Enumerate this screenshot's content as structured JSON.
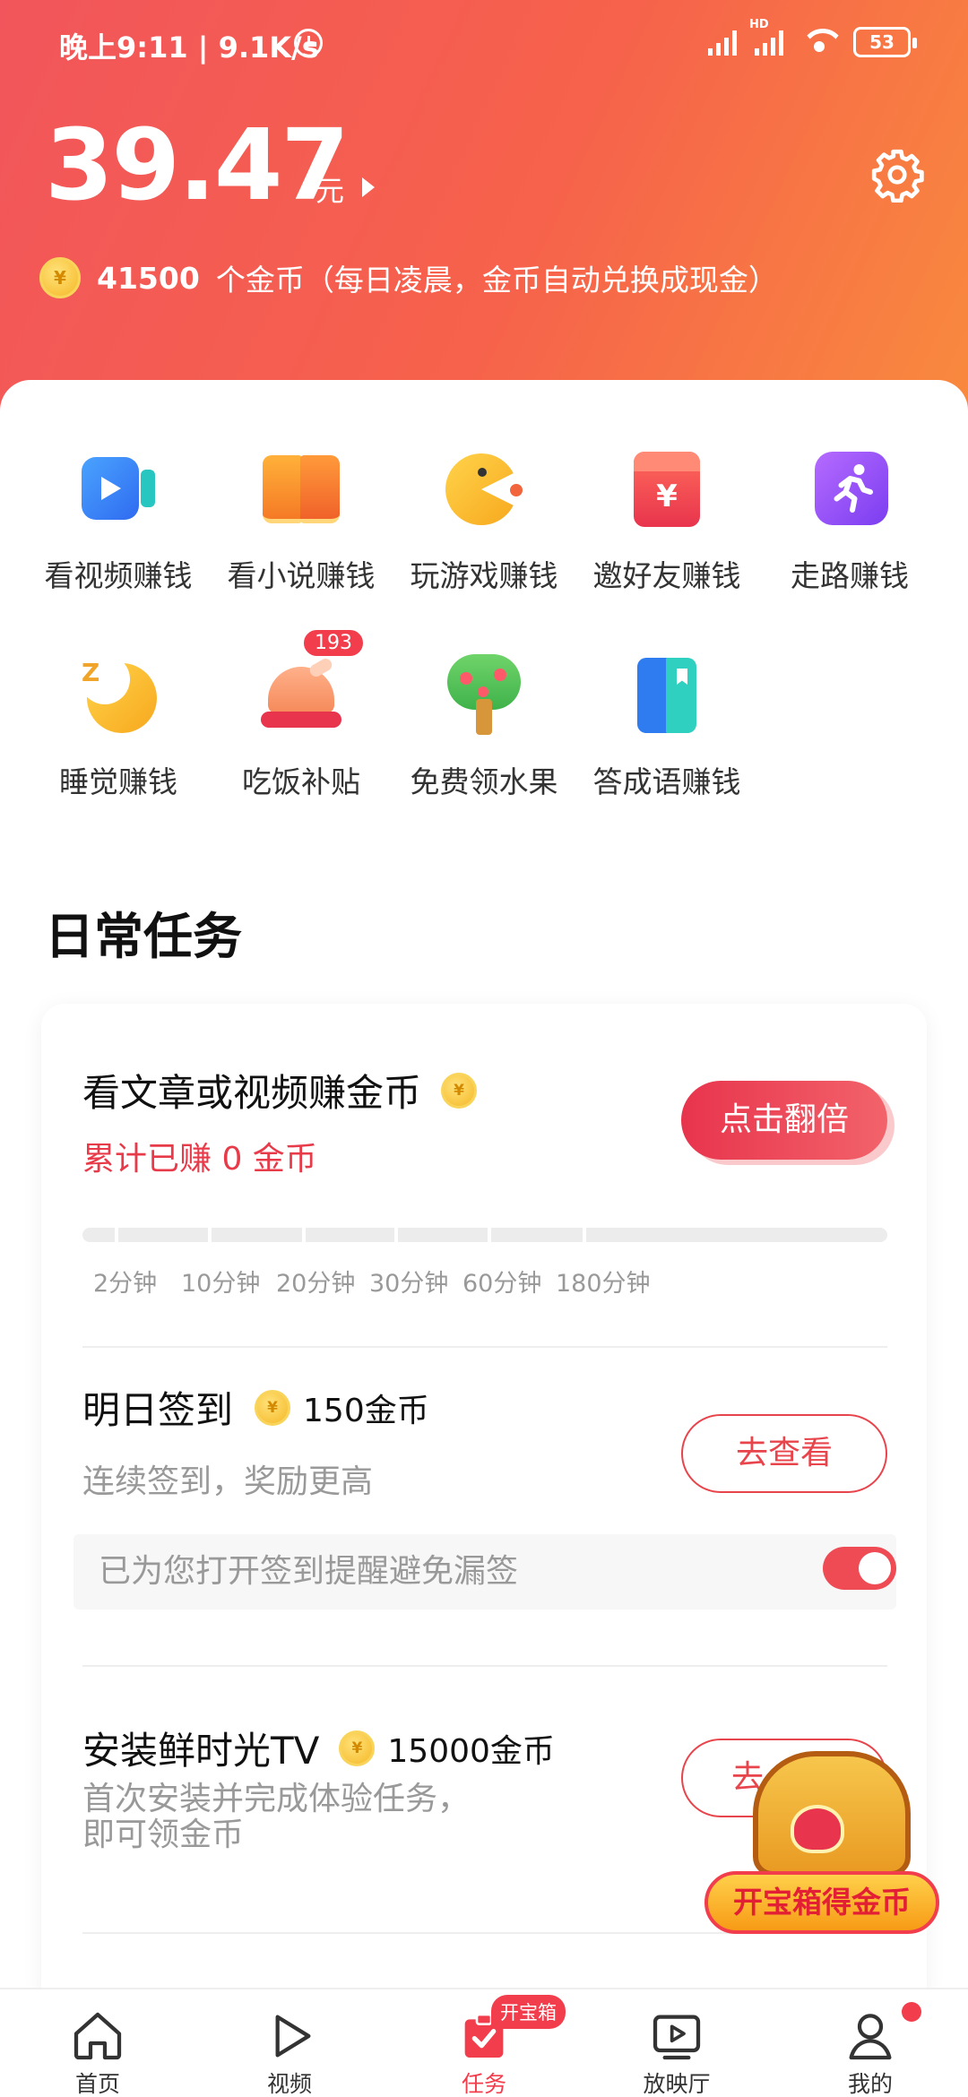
{
  "status_bar": {
    "time": "晚上9:11 | 9.1K/s",
    "network_hd": "HD",
    "battery": "53"
  },
  "wallet": {
    "balance": "39.47",
    "unit": "元",
    "coins": "41500",
    "coins_text": "个金币（每日凌晨，金币自动兑换成现金）"
  },
  "coin_glyph": "¥",
  "shortcuts": [
    {
      "label": "看视频赚钱",
      "icon": "video-icon"
    },
    {
      "label": "看小说赚钱",
      "icon": "book-icon"
    },
    {
      "label": "玩游戏赚钱",
      "icon": "pacman-game-icon"
    },
    {
      "label": "邀好友赚钱",
      "icon": "red-envelope-icon"
    },
    {
      "label": "走路赚钱",
      "icon": "running-icon"
    },
    {
      "label": "睡觉赚钱",
      "icon": "moon-icon"
    },
    {
      "label": "吃饭补贴",
      "icon": "chicken-meal-icon",
      "badge": "193"
    },
    {
      "label": "免费领水果",
      "icon": "fruit-tree-icon"
    },
    {
      "label": "答成语赚钱",
      "icon": "idiom-book-icon"
    }
  ],
  "daily": {
    "title": "日常任务",
    "task1": {
      "title": "看文章或视频赚金币",
      "earned": "累计已赚 0 金币",
      "button": "点击翻倍",
      "ticks": [
        "2分钟",
        "10分钟",
        "20分钟",
        "30分钟",
        "60分钟",
        "180分钟"
      ],
      "progress": 0
    },
    "task2": {
      "title": "明日签到",
      "reward": "150金币",
      "sub": "连续签到，奖励更高",
      "button": "去查看",
      "remind": "已为您打开签到提醒避免漏签",
      "toggle_on": true
    },
    "task3": {
      "title": "安装鲜时光TV",
      "reward": "15000金币",
      "sub": "首次安装并完成体验任务，即可领金币",
      "button_visible": "去"
    }
  },
  "treasure": {
    "label": "开宝箱得金币"
  },
  "tabbar": {
    "home": "首页",
    "video": "视频",
    "tasks": "任务",
    "cinema": "放映厅",
    "mine": "我的",
    "tasks_badge": "开宝箱"
  },
  "colors": {
    "accent": "#f23d4c",
    "header_start": "#f2555b",
    "header_end": "#f98a3e"
  }
}
